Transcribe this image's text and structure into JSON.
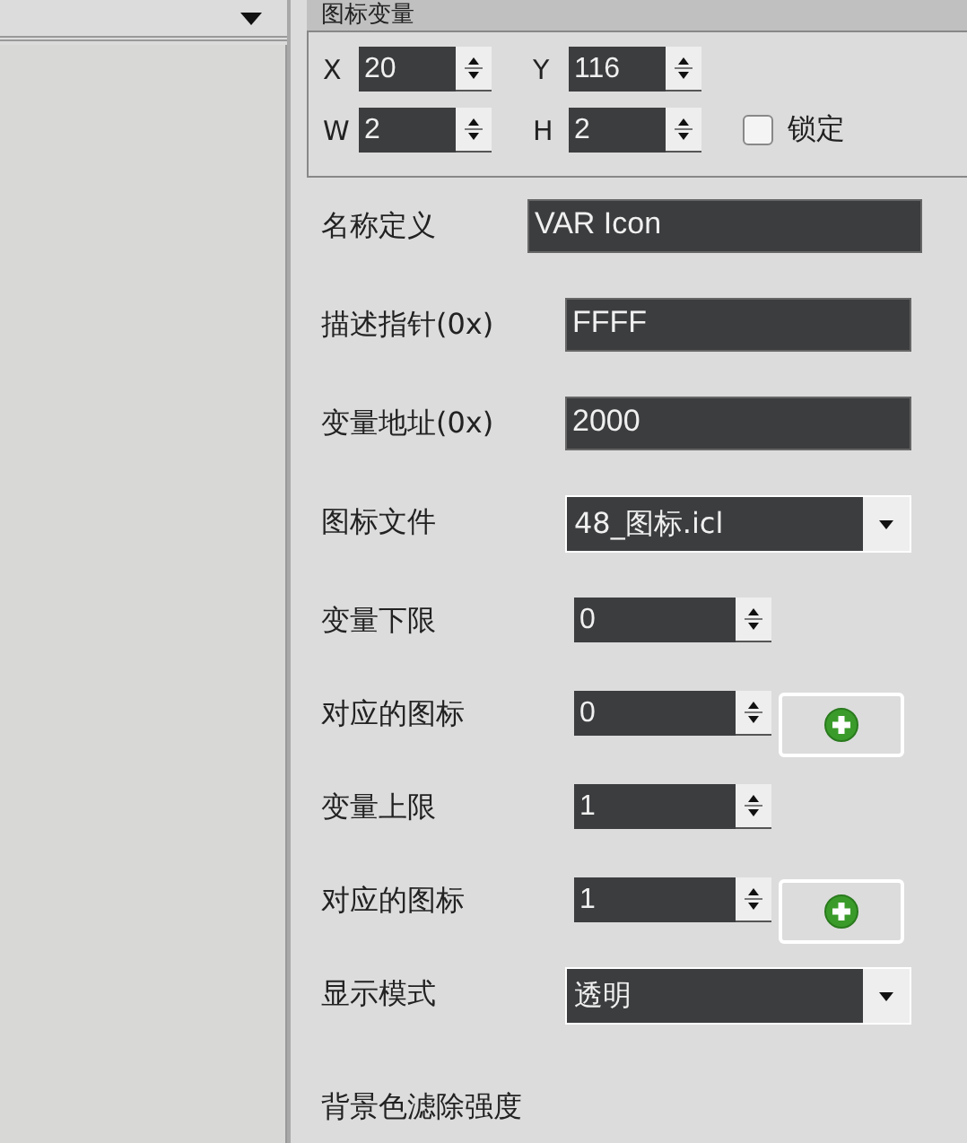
{
  "group": {
    "title": "图标变量",
    "coords": [
      {
        "label": "X",
        "value": "20"
      },
      {
        "label": "Y",
        "value": "116"
      },
      {
        "label": "W",
        "value": "2"
      },
      {
        "label": "H",
        "value": "2"
      }
    ],
    "lock": {
      "label": "锁定",
      "checked": false
    }
  },
  "rows": [
    {
      "kind": "text",
      "label": "名称定义",
      "value": "VAR Icon"
    },
    {
      "kind": "text",
      "label": "描述指针(0x)",
      "value": "FFFF"
    },
    {
      "kind": "text",
      "label": "变量地址(0x)",
      "value": "2000"
    },
    {
      "kind": "combo",
      "label": "图标文件",
      "value": "48_图标.icl"
    },
    {
      "kind": "spin",
      "label": "变量下限",
      "value": "0",
      "add_button": false
    },
    {
      "kind": "spin",
      "label": "对应的图标",
      "value": "0",
      "add_button": true
    },
    {
      "kind": "spin",
      "label": "变量上限",
      "value": "1",
      "add_button": false
    },
    {
      "kind": "spin",
      "label": "对应的图标",
      "value": "1",
      "add_button": true
    },
    {
      "kind": "combo",
      "label": "显示模式",
      "value": "透明"
    }
  ],
  "next_label": "背景色滤除强度"
}
